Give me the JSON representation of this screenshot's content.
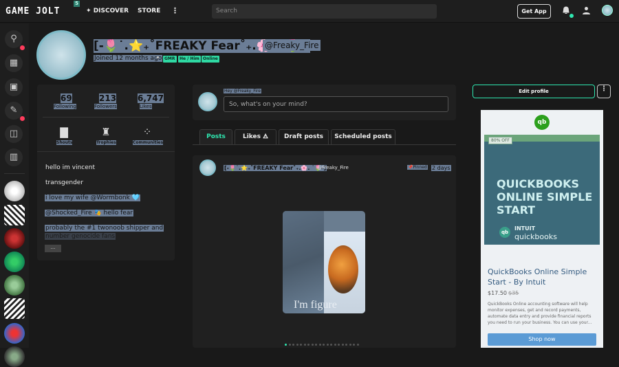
{
  "topbar": {
    "logo": "GAME JOLT",
    "logo_badge": "5",
    "nav_discover": "DISCOVER",
    "nav_store": "STORE",
    "more_glyph": "⋮",
    "search_placeholder": "Search",
    "get_app": "Get App",
    "icons": [
      "notifications-icon",
      "friends-icon",
      "user-avatar"
    ]
  },
  "sidebar": {
    "icons": [
      "trophy-icon",
      "store-icon",
      "backpack-icon",
      "creator-icon",
      "pack-icon",
      "library-icon"
    ],
    "notification_color": "#ff3c5c"
  },
  "profile": {
    "title": "[-🌷˙.⭐₊˚FREAKY Fear˚₊.🌸. ˙🌷-]",
    "username": "@Freaky_Fire",
    "joined": "Joined 12 months ago",
    "tags": [
      "GMR",
      "He / Him",
      "Online"
    ],
    "tag_color": "#2fd9a3"
  },
  "stats": [
    {
      "value": "69",
      "label": "Following"
    },
    {
      "value": "213",
      "label": "Followers"
    },
    {
      "value": "6,747",
      "label": "Likes"
    }
  ],
  "shortcuts": [
    {
      "label": "Shouts",
      "icon": "shouts-icon"
    },
    {
      "label": "Trophies",
      "icon": "trophy-icon"
    },
    {
      "label": "Communities",
      "icon": "communities-icon"
    }
  ],
  "bio": [
    "hello im vincent",
    "transgender",
    "i love my wife @Wormbonk 🩵",
    "@Shocked_Fire 🎭 hello fear",
    "probably the #1 twonoob shipper and",
    "number genocide fans"
  ],
  "bio_more": "...",
  "composer": {
    "greeting": "Hey @Freaky_Fire",
    "placeholder": "So, what's on your mind?"
  },
  "tabs": [
    {
      "label": "Posts",
      "active": true
    },
    {
      "label": "Likes 🜁",
      "active": false
    },
    {
      "label": "Draft posts",
      "active": false
    },
    {
      "label": "Scheduled posts",
      "active": false
    }
  ],
  "post": {
    "title": "[-🌷˙.⭐₊˚FREAKY Fear˚₊.🌸. ˙🌷-]",
    "username": "@Freaky_Fire",
    "pinned": "Pinned",
    "time": "2 days",
    "image_caption": "I'm figure",
    "carousel_count": 20
  },
  "right": {
    "edit_profile": "Edit profile",
    "kebab": "⋮"
  },
  "ad": {
    "logo": "qb",
    "badge": "80% OFF",
    "headline": "QUICKBOOKS ONLINE SIMPLE START",
    "intuit": "INTUIT",
    "quickbooks": "quickbooks",
    "title": "QuickBooks Online Simple Start - By Intuit",
    "price": "$17.50",
    "old_price": "$35",
    "description": "QuickBooks Online accounting software will help monitor expenses, get and record payments, automate data entry and provide financial reports you need to run your business. You can use your...",
    "button": "Shop now"
  },
  "colors": {
    "accent": "#2fe7b0",
    "background": "#191919"
  }
}
